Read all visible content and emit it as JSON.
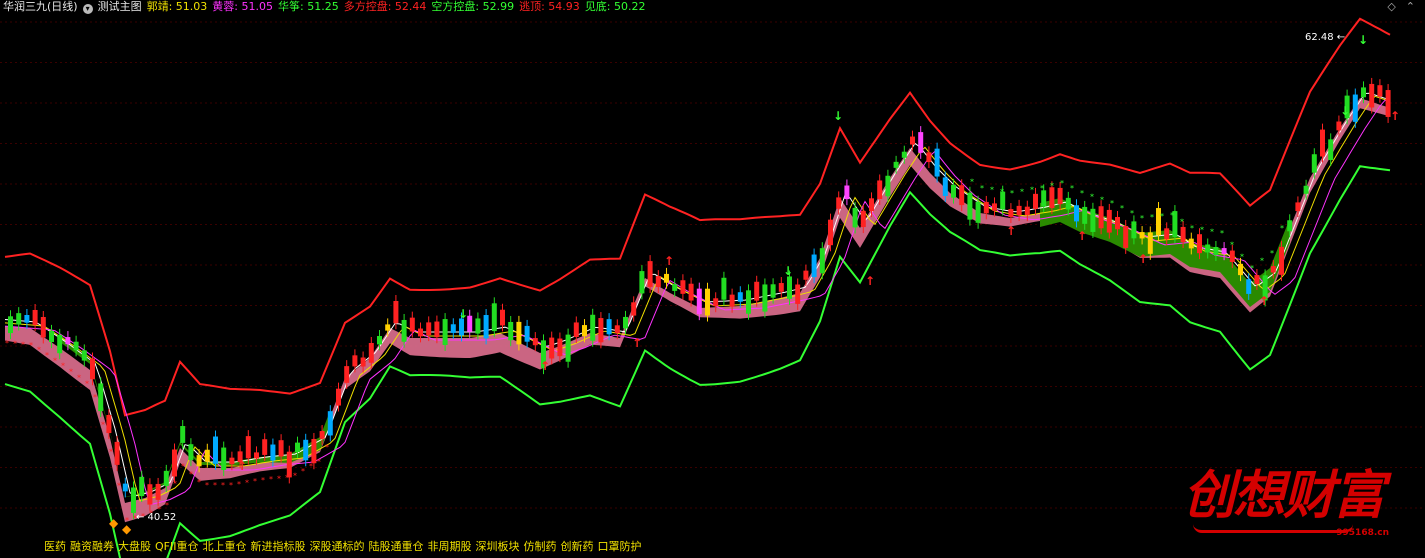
{
  "header": {
    "title": "华润三九(日线)",
    "dropdown_icon": "chevron-down-icon",
    "main_indicator": "测试主图",
    "values": [
      {
        "name": "郭靖:",
        "value": "51.03",
        "color": "#f0e000"
      },
      {
        "name": "黄蓉:",
        "value": "51.05",
        "color": "#ff33ff"
      },
      {
        "name": "华筝:",
        "value": "51.25",
        "color": "#33ff33"
      },
      {
        "name": "多方控盘:",
        "value": "52.44",
        "color": "#ff2222"
      },
      {
        "name": "空方控盘:",
        "value": "52.99",
        "color": "#33ff33"
      },
      {
        "name": "逃顶:",
        "value": "54.93",
        "color": "#ff2222"
      },
      {
        "name": "见底:",
        "value": "50.22",
        "color": "#33ff33"
      }
    ],
    "right_icons": [
      "collapse-up-icon",
      "expand-icon"
    ]
  },
  "chart_data": {
    "type": "candlestick",
    "high_label": "62.48",
    "low_label": "40.52",
    "colors": {
      "upper_band": "#ff2222",
      "lower_band": "#33ff33",
      "ma_fast": "#f0e000",
      "ma_mid": "#ff33ff",
      "ma_slow": "#33ff33",
      "bull_cloud": "#e07090",
      "bear_cloud": "#2a8a00",
      "up_candle": "#ff2222",
      "down_candle": "#22dd22",
      "strong_up": "#ffd000",
      "strong_down": "#00aaff",
      "mixed": "#ff44ff"
    }
  },
  "footer": {
    "tags": [
      "医药",
      "融资融券",
      "大盘股",
      "QFII重仓",
      "北上重仓",
      "新进指标股",
      "深股通标的",
      "陆股通重仓",
      "非周期股",
      "深圳板块",
      "仿制药",
      "创新药",
      "口罩防护"
    ]
  },
  "watermark": {
    "text": "创想财富",
    "url": "995168.cn"
  }
}
